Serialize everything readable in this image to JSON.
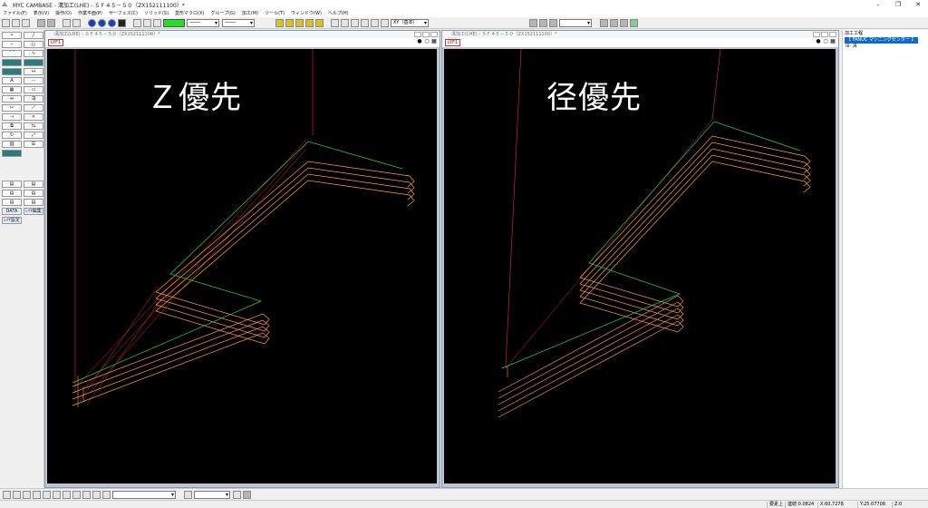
{
  "window": {
    "title": "MYC CAMBASE - 溝加工(LHE) - ＳＦ４５－５０（ZX152111100）*",
    "controls": [
      "–",
      "❐",
      "✕"
    ]
  },
  "menu": [
    "ファイル(F)",
    "表示(V)",
    "操作(O)",
    "作業平面(P)",
    "サーフェス(C)",
    "ソリッド(S)",
    "変形マクロ(X)",
    "グループ(G)",
    "加工(M)",
    "ツール(T)",
    "ウィンドウ(W)",
    "ヘルプ(H)"
  ],
  "toolbar": {
    "current_color": "#22e022",
    "line_type": "────",
    "line_width": "────",
    "view_combo": "XY（基本）"
  },
  "palette": {
    "data_label": "DATA",
    "edit_label": "ﾚｲﾔ編集",
    "settings_label": "ﾚｲﾔ設定"
  },
  "left_window": {
    "title": "溝加工(LHE) - ＳＦ４５－５０（ZX152111100）*",
    "tab": "LYF1",
    "overlay": "Ｚ優先"
  },
  "right_window": {
    "title": "溝加工(LHE) - ＳＦ４５－５０（ZX152111100）*",
    "tab": "LYF1",
    "overlay": "径優先"
  },
  "tree": {
    "root": "加工工程",
    "selected": "【 FANUC マシニングセンター 】",
    "child": "溝"
  },
  "bottom": {
    "field1": "",
    "field2": ""
  },
  "status": {
    "mode": "要素上",
    "snap": "連続:0.0824",
    "x": "X:60.7278",
    "y": "Y:25.07708",
    "z": "Z:0"
  },
  "colors": {
    "toolpath": "#ff9a4a",
    "rapid": "#e23030",
    "contour": "#31d431",
    "viewport_bg": "#000000"
  }
}
